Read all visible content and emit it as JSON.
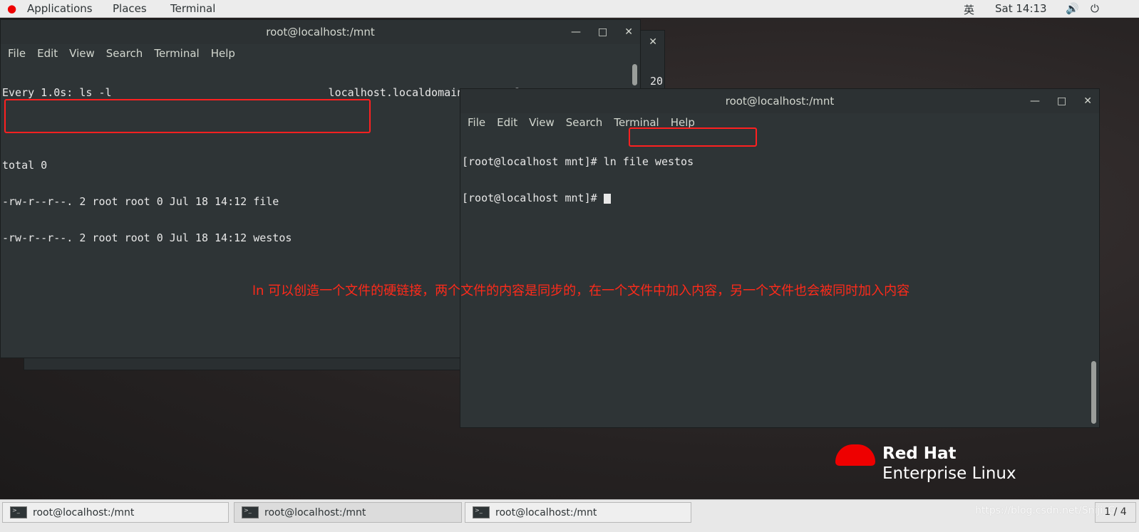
{
  "topbar": {
    "applications": "Applications",
    "places": "Places",
    "terminal": "Terminal",
    "input_method": "英",
    "clock": "Sat 14:13"
  },
  "window1": {
    "title": "root@localhost:/mnt",
    "menu": [
      "File",
      "Edit",
      "View",
      "Search",
      "Terminal",
      "Help"
    ],
    "header_left": "Every 1.0s: ls -l",
    "header_right": "localhost.localdomain: Sat Jul 18 14:13:18 2020",
    "lines": [
      "total 0",
      "-rw-r--r--. 2 root root 0 Jul 18 14:12 file",
      "-rw-r--r--. 2 root root 0 Jul 18 14:12 westos"
    ]
  },
  "window_back": {
    "partial_text": "20"
  },
  "window2": {
    "title": "root@localhost:/mnt",
    "menu": [
      "File",
      "Edit",
      "View",
      "Search",
      "Terminal",
      "Help"
    ],
    "prompt": "[root@localhost mnt]#",
    "command": " ln file westos"
  },
  "annotation": "ln 可以创造一个文件的硬链接，两个文件的内容是同步的，在一个文件中加入内容，另一个文件也会被同时加入内容",
  "logo": {
    "line1": "Red Hat",
    "line2": "Enterprise Linux"
  },
  "taskbar": {
    "tasks": [
      "root@localhost:/mnt",
      "root@localhost:/mnt",
      "root@localhost:/mnt"
    ],
    "workspace": "1 / 4",
    "watermark": "https://blog.csdn.net/Sniji_G"
  },
  "colors": {
    "highlight": "#ff2020",
    "terminal_bg": "#2e3436",
    "annotation": "#ff2a1a"
  }
}
